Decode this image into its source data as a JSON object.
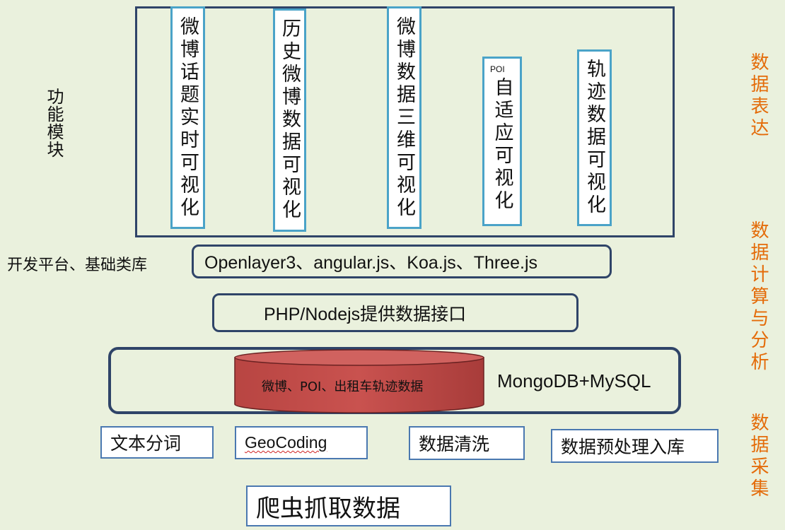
{
  "function_label": "功能模块",
  "modules": [
    {
      "text": "微博话题实时可视化"
    },
    {
      "text": "历史微博数据可视化"
    },
    {
      "text": "微博数据三维可视化"
    },
    {
      "prefix": "POI",
      "text": "自适应可视化"
    },
    {
      "text": "轨迹数据可视化"
    }
  ],
  "platform_label": "开发平台、基础类库",
  "platform_box": "Openlayer3、angular.js、Koa.js、Three.js",
  "api_box": "PHP/Nodejs提供数据接口",
  "db": {
    "cylinder_label": "微博、POI、出租车轨迹数据",
    "db_text": "MongoDB+MySQL"
  },
  "processing": [
    "文本分词",
    "GeoCoding",
    "数据清洗",
    "数据预处理入库"
  ],
  "crawler": "爬虫抓取数据",
  "side_labels": [
    "数据表达",
    "数据计算与分析",
    "数据采集"
  ],
  "colors": {
    "background": "#eaf1dd",
    "frame": "#2f4468",
    "module_border": "#4aa3c8",
    "cylinder": "#c0504d",
    "side_text": "#e46c0a"
  }
}
